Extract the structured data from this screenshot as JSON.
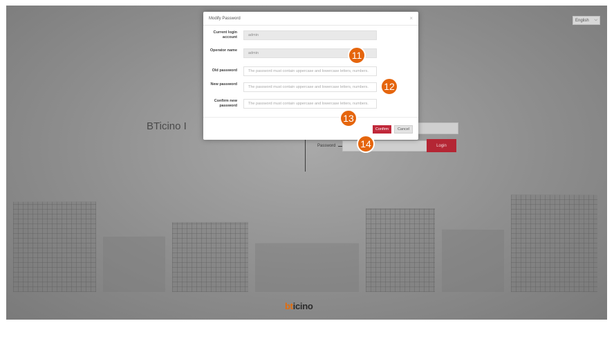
{
  "language_selector": {
    "value": "English"
  },
  "login_page": {
    "brand_title": "BTicino I",
    "password_label": "Password",
    "login_button": "Login",
    "logo_part1": "bt",
    "logo_part2": "icino"
  },
  "dialog": {
    "title": "Modify Password",
    "close": "×",
    "fields": [
      {
        "label": "Current login account",
        "value": "admin",
        "placeholder": ""
      },
      {
        "label": "Operator name",
        "value": "admin",
        "placeholder": ""
      },
      {
        "label": "Old password",
        "value": "",
        "placeholder": "The password must contain uppercase and lowercase letters, numbers."
      },
      {
        "label": "New password",
        "value": "",
        "placeholder": "The password must contain uppercase and lowercase letters, numbers."
      },
      {
        "label": "Confirm new password",
        "value": "",
        "placeholder": "The password must contain uppercase and lowercase letters, numbers."
      }
    ],
    "confirm_button": "Confirm",
    "cancel_button": "Cancel"
  },
  "callouts": [
    "11",
    "12",
    "13",
    "14"
  ],
  "colors": {
    "accent": "#c0283a",
    "callout": "#e5650d",
    "logo": "#e46c0a"
  }
}
